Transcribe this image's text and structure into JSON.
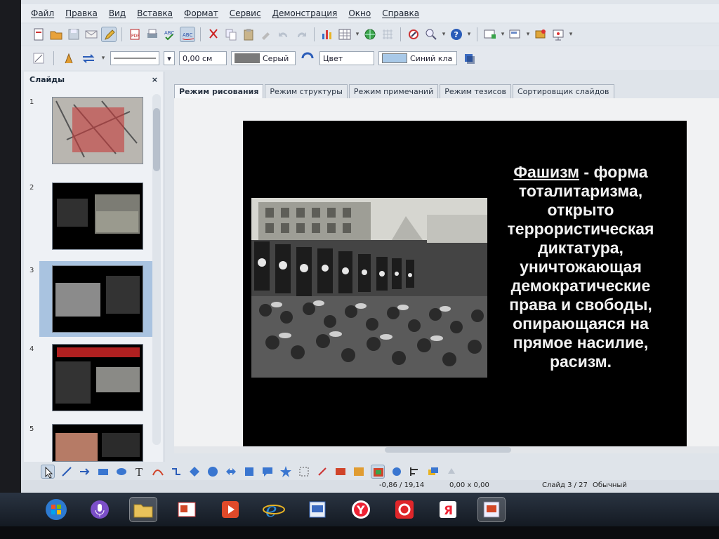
{
  "menubar": {
    "items": [
      "Файл",
      "Правка",
      "Вид",
      "Вставка",
      "Формат",
      "Сервис",
      "Демонстрация",
      "Окно",
      "Справка"
    ]
  },
  "toolbar2": {
    "line_width": "0,00 см",
    "area_color": "Серый",
    "area_style": "Цвет",
    "fill_color": "Синий кла"
  },
  "slides_pane": {
    "title": "Слайды",
    "close_label": "×",
    "thumbnails": [
      {
        "number": "1"
      },
      {
        "number": "2"
      },
      {
        "number": "3"
      },
      {
        "number": "4"
      },
      {
        "number": "5"
      }
    ]
  },
  "tabs": [
    "Режим рисования",
    "Режим структуры",
    "Режим примечаний",
    "Режим тезисов",
    "Сортировщик слайдов"
  ],
  "slide": {
    "term": "Фашизм",
    "definition": " - форма тоталитаризма, открыто террористическая диктатура, уничтожающая демократические права и свободы, опирающаяся на прямое насилие, расизм."
  },
  "status": {
    "position": "-0,86 / 19,14",
    "size": "0,00 x 0,00",
    "slide_counter": "Слайд 3 / 27",
    "layout": "Обычный"
  },
  "icons": {
    "taskbar": [
      "windows-start-icon",
      "microphone-app-icon",
      "file-explorer-icon",
      "presentation-app-icon",
      "media-player-icon",
      "internet-explorer-icon",
      "impress-icon",
      "yandex-browser-icon",
      "opera-browser-icon",
      "yandex-icon",
      "remote-desktop-icon"
    ]
  },
  "colors": {
    "area_swatch": "#7a7a7a",
    "fill_swatch": "#a9c9e8",
    "slide_background": "#000000",
    "slide_text": "#f2f2f2"
  }
}
